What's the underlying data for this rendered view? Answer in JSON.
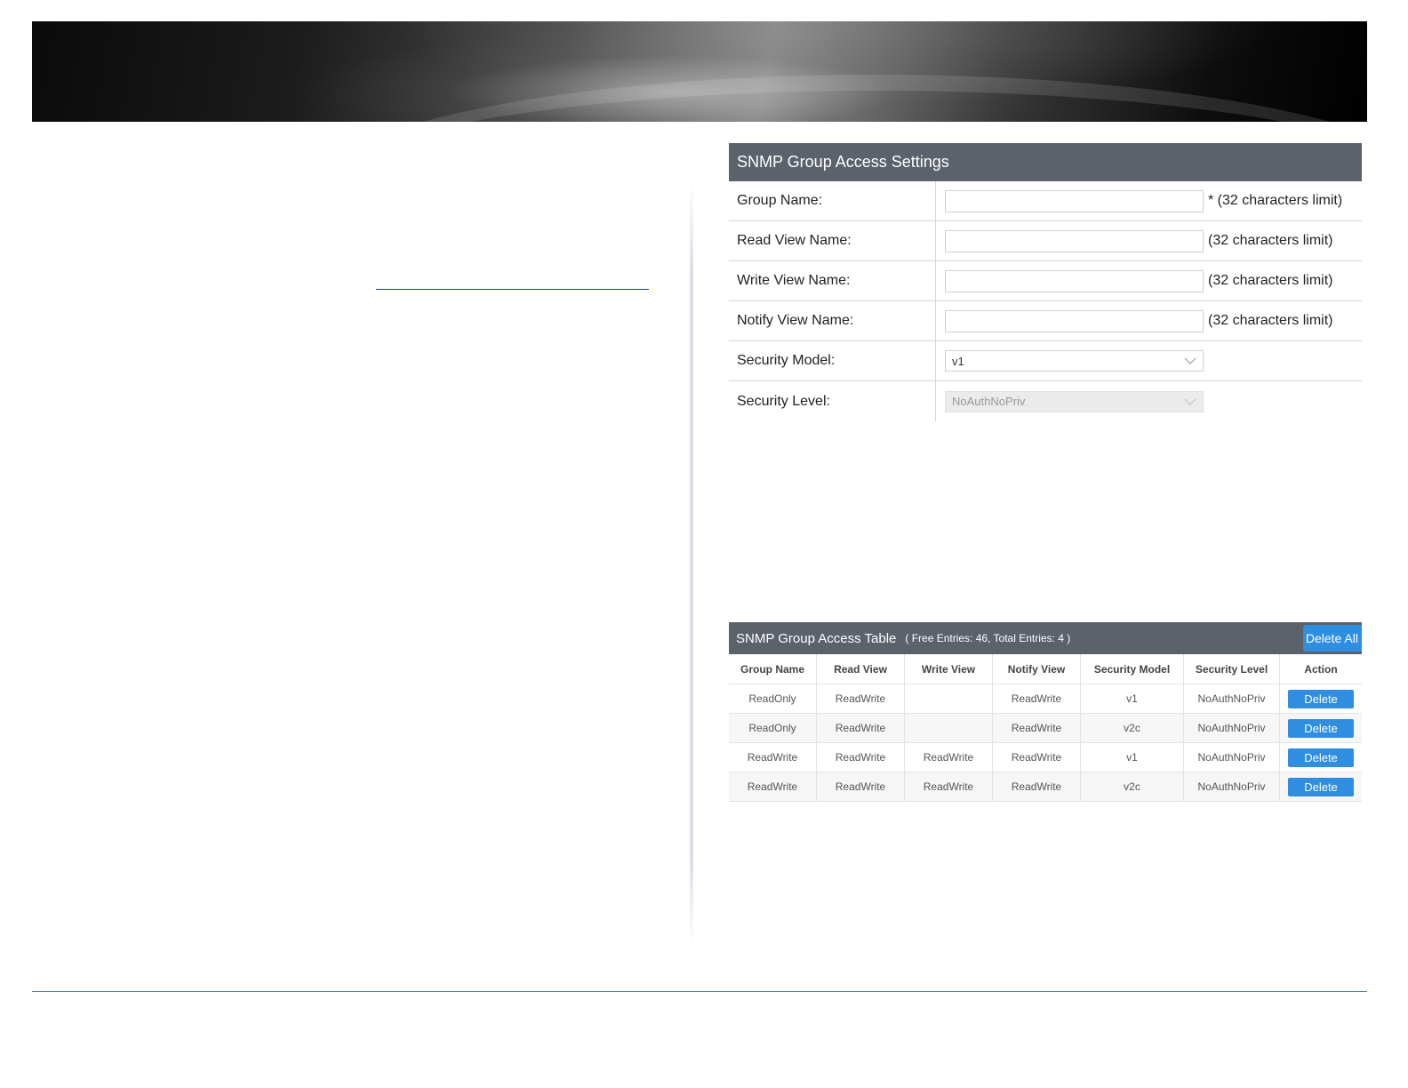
{
  "settings": {
    "title": "SNMP Group Access Settings",
    "rows": [
      {
        "label": "Group Name:",
        "value": "",
        "hint": "* (32 characters limit)"
      },
      {
        "label": "Read View Name:",
        "value": "",
        "hint": "(32 characters limit)"
      },
      {
        "label": "Write View Name:",
        "value": "",
        "hint": "(32 characters limit)"
      },
      {
        "label": "Notify View Name:",
        "value": "",
        "hint": "(32 characters limit)"
      }
    ],
    "security_model": {
      "label": "Security Model:",
      "selected": "v1"
    },
    "security_level": {
      "label": "Security Level:",
      "selected": "NoAuthNoPriv",
      "disabled": true
    }
  },
  "table": {
    "title": "SNMP Group Access Table",
    "subtitle": "( Free Entries: 46, Total Entries: 4 )",
    "delete_all_label": "Delete All",
    "columns": [
      "Group Name",
      "Read View",
      "Write View",
      "Notify View",
      "Security Model",
      "Security Level",
      "Action"
    ],
    "rows": [
      {
        "group": "ReadOnly",
        "read": "ReadWrite",
        "write": "",
        "notify": "ReadWrite",
        "model": "v1",
        "level": "NoAuthNoPriv",
        "action": "Delete"
      },
      {
        "group": "ReadOnly",
        "read": "ReadWrite",
        "write": "",
        "notify": "ReadWrite",
        "model": "v2c",
        "level": "NoAuthNoPriv",
        "action": "Delete"
      },
      {
        "group": "ReadWrite",
        "read": "ReadWrite",
        "write": "ReadWrite",
        "notify": "ReadWrite",
        "model": "v1",
        "level": "NoAuthNoPriv",
        "action": "Delete"
      },
      {
        "group": "ReadWrite",
        "read": "ReadWrite",
        "write": "ReadWrite",
        "notify": "ReadWrite",
        "model": "v2c",
        "level": "NoAuthNoPriv",
        "action": "Delete"
      }
    ]
  },
  "colors": {
    "panel_header": "#5b626c",
    "button_blue": "#2f8ee0",
    "link_blue": "#1a3fc0",
    "footer_line": "#3b7bd0"
  },
  "icons": {
    "select_arrow": "chevron-down-icon"
  }
}
